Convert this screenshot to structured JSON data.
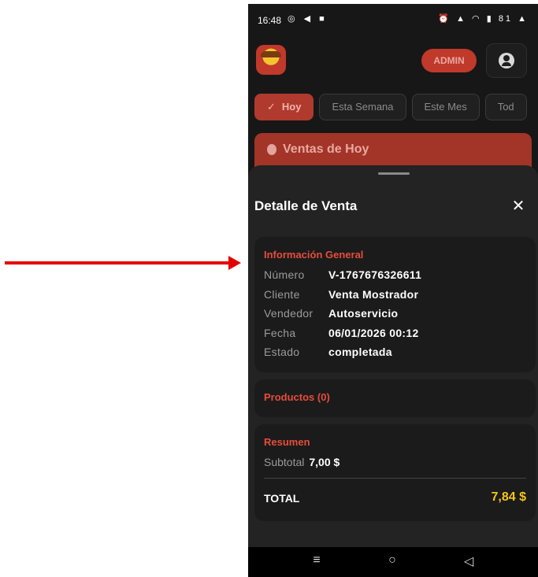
{
  "status_bar": {
    "time": "16:48",
    "left_icons": "◎ ◀ ■",
    "right_icons": "⏰ ▲ ◠ ▮ 81 ▲"
  },
  "app_bar": {
    "badge": "ADMIN"
  },
  "filters": [
    {
      "label": "Hoy",
      "active": true
    },
    {
      "label": "Esta Semana",
      "active": false
    },
    {
      "label": "Este Mes",
      "active": false
    },
    {
      "label": "Tod",
      "active": false
    }
  ],
  "sales_card": {
    "title": "Ventas de Hoy"
  },
  "sheet": {
    "title": "Detalle de Venta",
    "close": "✕",
    "general": {
      "title": "Información General",
      "rows": [
        {
          "key": "Número",
          "value": "V-1767676326611"
        },
        {
          "key": "Cliente",
          "value": "Venta Mostrador"
        },
        {
          "key": "Vendedor",
          "value": "Autoservicio"
        },
        {
          "key": "Fecha",
          "value": "06/01/2026 00:12"
        },
        {
          "key": "Estado",
          "value": "completada"
        }
      ]
    },
    "products": {
      "title": "Productos (0)"
    },
    "summary": {
      "title": "Resumen",
      "subtotal_label": "Subtotal",
      "subtotal_value": "7,00 $",
      "total_label": "TOTAL",
      "total_value": "7,84 $"
    }
  },
  "nav_bar": {
    "menu": "≡",
    "home": "○",
    "back": "◁"
  },
  "colors": {
    "accent": "#c0392b",
    "section_title": "#e74c3c",
    "total": "#f5c518",
    "annotation_arrow": "#e50000"
  }
}
